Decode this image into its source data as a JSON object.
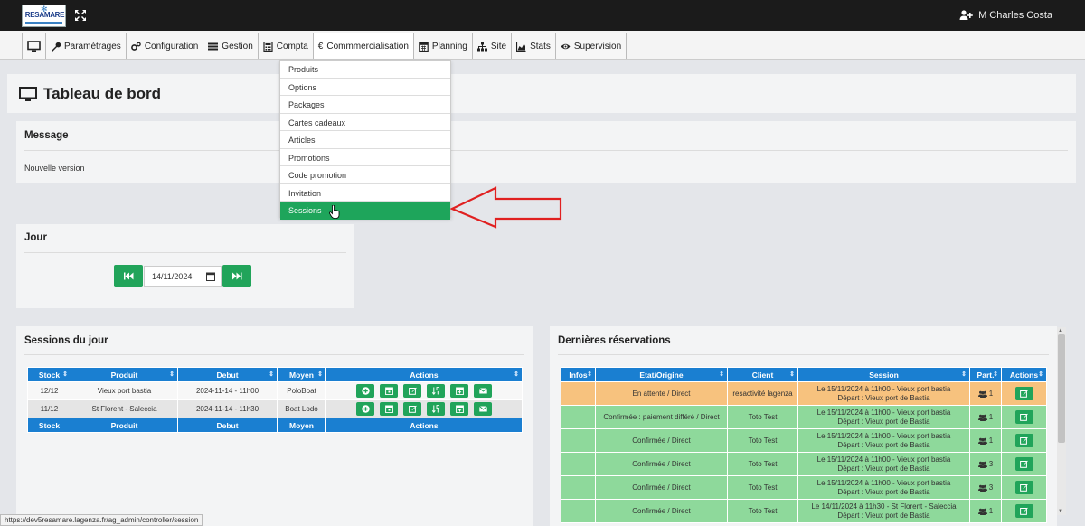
{
  "brand": {
    "logo_text": "RESAMARE"
  },
  "user": {
    "name": "M Charles Costa"
  },
  "nav": [
    {
      "label": "",
      "icon": "monitor-icon"
    },
    {
      "label": "Paramétrages",
      "icon": "wrench-icon"
    },
    {
      "label": "Configuration",
      "icon": "gears-icon"
    },
    {
      "label": "Gestion",
      "icon": "list-icon"
    },
    {
      "label": "Compta",
      "icon": "calculator-icon"
    },
    {
      "label": "Commmercialisation",
      "icon": "euro-icon"
    },
    {
      "label": "Planning",
      "icon": "calendar-icon"
    },
    {
      "label": "Site",
      "icon": "sitemap-icon"
    },
    {
      "label": "Stats",
      "icon": "area-chart-icon"
    },
    {
      "label": "Supervision",
      "icon": "eye-icon"
    }
  ],
  "dropdown": {
    "items": [
      "Produits",
      "Options",
      "Packages",
      "Cartes cadeaux",
      "Articles",
      "Promotions",
      "Code promotion",
      "Invitation",
      "Sessions"
    ],
    "highlighted": "Sessions"
  },
  "page": {
    "title": "Tableau de bord"
  },
  "message_panel": {
    "title": "Message",
    "text": "Nouvelle version"
  },
  "day_panel": {
    "title": "Jour",
    "date": "14/11/2024"
  },
  "sessions_panel": {
    "title": "Sessions du jour",
    "headers": [
      "Stock",
      "Produit",
      "Debut",
      "Moyen",
      "Actions"
    ],
    "footer": [
      "Stock",
      "Produit",
      "Debut",
      "Moyen",
      "Actions"
    ],
    "rows": [
      {
        "stock": "12/12",
        "produit": "Vieux port bastia",
        "debut": "2024-11-14 - 11h00",
        "moyen": "PoloBoat"
      },
      {
        "stock": "11/12",
        "produit": "St Florent - Saleccia",
        "debut": "2024-11-14 - 11h30",
        "moyen": "Boat Lodo"
      }
    ],
    "action_icons": [
      "plus-circle-icon",
      "calendar-day-icon",
      "edit-icon",
      "sort-numeric-icon",
      "calendar-plus-icon",
      "envelope-icon"
    ]
  },
  "reservations_panel": {
    "title": "Dernières réservations",
    "headers": [
      "Infos",
      "Etat/Origine",
      "Client",
      "Session",
      "Part.",
      "Actions"
    ],
    "rows": [
      {
        "etat": "En attente / Direct",
        "client": "resactivité lagenza",
        "session1": "Le 15/11/2024 à 11h00 - Vieux port bastia",
        "session2": "Départ : Vieux port de Bastia",
        "part": "1",
        "status": "pending"
      },
      {
        "etat": "Confirmée : paiement différé / Direct",
        "client": "Toto Test",
        "session1": "Le 15/11/2024 à 11h00 - Vieux port bastia",
        "session2": "Départ : Vieux port de Bastia",
        "part": "1",
        "status": "ok"
      },
      {
        "etat": "Confirmée / Direct",
        "client": "Toto Test",
        "session1": "Le 15/11/2024 à 11h00 - Vieux port bastia",
        "session2": "Départ : Vieux port de Bastia",
        "part": "1",
        "status": "ok"
      },
      {
        "etat": "Confirmée / Direct",
        "client": "Toto Test",
        "session1": "Le 15/11/2024 à 11h00 - Vieux port bastia",
        "session2": "Départ : Vieux port de Bastia",
        "part": "3",
        "status": "ok"
      },
      {
        "etat": "Confirmée / Direct",
        "client": "Toto Test",
        "session1": "Le 15/11/2024 à 11h00 - Vieux port bastia",
        "session2": "Départ : Vieux port de Bastia",
        "part": "3",
        "status": "ok"
      },
      {
        "etat": "Confirmée / Direct",
        "client": "Toto Test",
        "session1": "Le 14/11/2024 à 11h30 - St Florent - Saleccia",
        "session2": "Départ : Vieux port de Bastia",
        "part": "1",
        "status": "ok"
      }
    ]
  },
  "status_url": "https://dev5resamare.lagenza.fr/ag_admin/controller/session",
  "colors": {
    "accent_green": "#21a45a",
    "table_blue": "#1a7fd1",
    "pending_orange": "#f7c27e",
    "ok_green": "#8ed99b",
    "arrow_red": "#e02020"
  }
}
